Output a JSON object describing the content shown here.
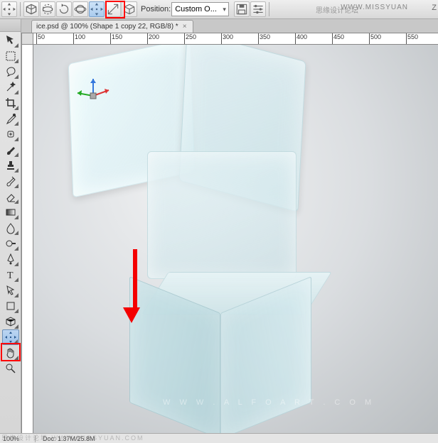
{
  "toolbar": {
    "position_label": "Position:",
    "position_value": "Custom O...",
    "watermark": "WWW.MISSYUAN",
    "right_cut": "Z"
  },
  "icons": {
    "move3d": "move-3d",
    "cube": "cube",
    "rotate": "rotate",
    "orbit": "orbit",
    "pan": "pan",
    "scale": "scale",
    "cube2": "cube",
    "save": "floppy",
    "settings": "gear"
  },
  "tab": {
    "title": "ice.psd @ 100% (Shape 1 copy 22, RGB/8) *"
  },
  "ruler": {
    "ticks": [
      "50",
      "100",
      "150",
      "200",
      "250",
      "300",
      "350",
      "400",
      "450",
      "500",
      "550"
    ],
    "spacing_px": 52
  },
  "canvas": {
    "watermark_center": "W W W . A L F O A R T . C O M"
  },
  "status": {
    "zoom": "100%",
    "doc": "Doc: 1.37M/25.8M",
    "watermark": "思缘设计论坛  WWW.MISSYUAN.COM"
  },
  "top_chinese": "思缘设计论坛"
}
